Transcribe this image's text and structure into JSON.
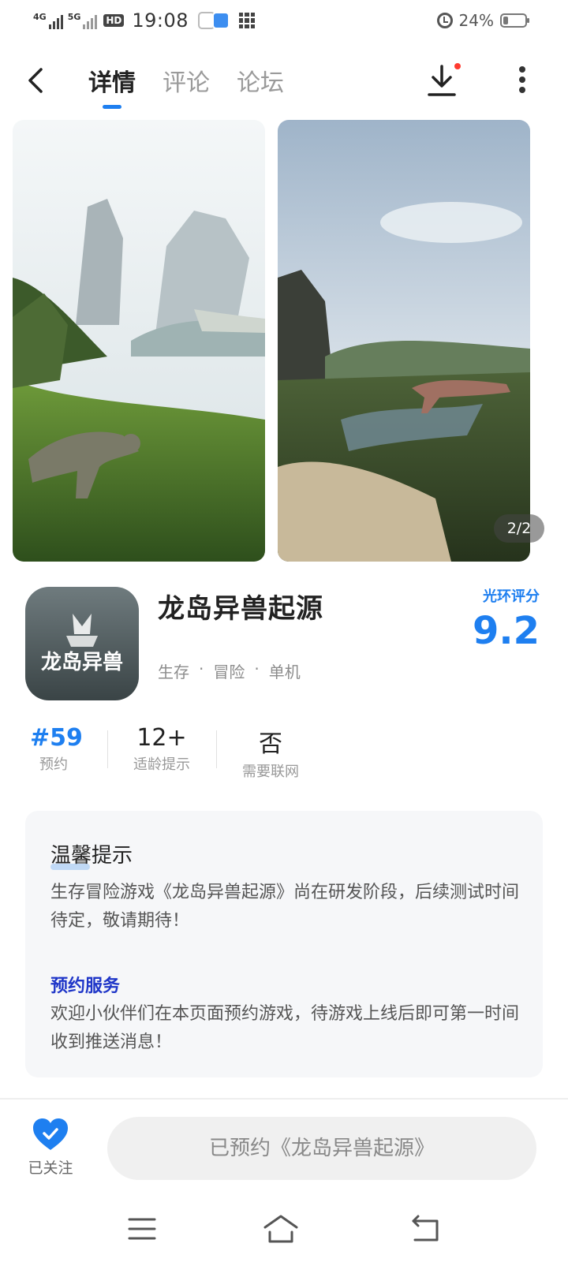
{
  "status_bar": {
    "network_1": "4G",
    "network_2": "5G",
    "hd_badge": "HD",
    "time": "19:08",
    "battery_text": "24%",
    "battery_level": 0.24
  },
  "nav": {
    "tabs": [
      {
        "label": "详情",
        "active": true
      },
      {
        "label": "评论",
        "active": false
      },
      {
        "label": "论坛",
        "active": false
      }
    ],
    "has_download_badge": true
  },
  "gallery": {
    "counter": "2/2"
  },
  "app": {
    "title": "龙岛异兽起源",
    "tags": [
      "生存",
      "·",
      "冒险",
      "·",
      "单机"
    ],
    "icon_text": "龙岛异兽",
    "rating_label": "光环评分",
    "rating_value": "9.2"
  },
  "stats": [
    {
      "value": "#59",
      "label": "预约"
    },
    {
      "value": "12+",
      "label": "适龄提示"
    },
    {
      "value": "否",
      "label": "需要联网"
    }
  ],
  "notice": {
    "title": "温馨提示",
    "body": "生存冒险游戏《龙岛异兽起源》尚在研发阶段，后续测试时间待定，敬请期待！",
    "sub_title": "预约服务",
    "sub_body": "欢迎小伙伴们在本页面预约游戏，待游戏上线后即可第一时间收到推送消息！"
  },
  "bottom": {
    "follow_label": "已关注",
    "reserve_button": "已预约《龙岛异兽起源》"
  },
  "colors": {
    "accent": "#1e7ff0",
    "link": "#1f36c8",
    "notification_dot": "#ff3b30"
  }
}
